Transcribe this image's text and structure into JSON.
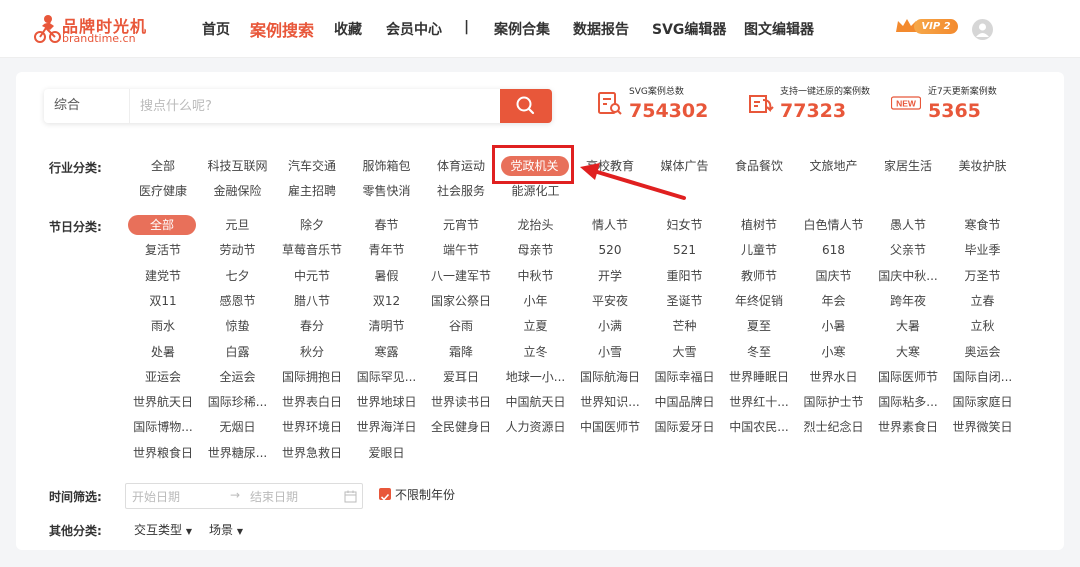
{
  "brand": {
    "name_cn": "品牌时光机",
    "name_en": "brandtime.cn"
  },
  "nav": [
    "首页",
    "案例搜索",
    "收藏",
    "会员中心",
    "|",
    "案例合集",
    "数据报告",
    "SVG编辑器",
    "图文编辑器"
  ],
  "nav_active": "案例搜索",
  "vip_label": "VIP 2",
  "search": {
    "type": "综合",
    "placeholder": "搜点什么呢?"
  },
  "stats": [
    {
      "label": "SVG案例总数",
      "value": "754302",
      "icon": "document-search-icon"
    },
    {
      "label": "支持一键还原的案例数",
      "value": "77323",
      "icon": "restore-icon"
    },
    {
      "label": "近7天更新案例数",
      "value": "5365",
      "icon": "new-badge-icon",
      "badge": "NEW"
    }
  ],
  "industry": {
    "label": "行业分类:",
    "row1": [
      "全部",
      "科技互联网",
      "汽车交通",
      "服饰箱包",
      "体育运动",
      "党政机关",
      "高校教育",
      "媒体广告",
      "食品餐饮",
      "文旅地产",
      "家居生活",
      "美妆护肤"
    ],
    "row2": [
      "医疗健康",
      "金融保险",
      "雇主招聘",
      "零售快消",
      "社会服务",
      "能源化工"
    ],
    "selected": "党政机关"
  },
  "festival": {
    "label": "节日分类:",
    "selected": "全部",
    "rows": [
      [
        "全部",
        "元旦",
        "除夕",
        "春节",
        "元宵节",
        "龙抬头",
        "情人节",
        "妇女节",
        "植树节",
        "白色情人节",
        "愚人节",
        "寒食节"
      ],
      [
        "复活节",
        "劳动节",
        "草莓音乐节",
        "青年节",
        "端午节",
        "母亲节",
        "520",
        "521",
        "儿童节",
        "618",
        "父亲节",
        "毕业季"
      ],
      [
        "建党节",
        "七夕",
        "中元节",
        "暑假",
        "八一建军节",
        "中秋节",
        "开学",
        "重阳节",
        "教师节",
        "国庆节",
        "国庆中秋...",
        "万圣节"
      ],
      [
        "双11",
        "感恩节",
        "腊八节",
        "双12",
        "国家公祭日",
        "小年",
        "平安夜",
        "圣诞节",
        "年终促销",
        "年会",
        "跨年夜",
        "立春"
      ],
      [
        "雨水",
        "惊蛰",
        "春分",
        "清明节",
        "谷雨",
        "立夏",
        "小满",
        "芒种",
        "夏至",
        "小暑",
        "大暑",
        "立秋"
      ],
      [
        "处暑",
        "白露",
        "秋分",
        "寒露",
        "霜降",
        "立冬",
        "小雪",
        "大雪",
        "冬至",
        "小寒",
        "大寒",
        "奥运会"
      ],
      [
        "亚运会",
        "全运会",
        "国际拥抱日",
        "国际罕见...",
        "爱耳日",
        "地球一小...",
        "国际航海日",
        "国际幸福日",
        "世界睡眠日",
        "世界水日",
        "国际医师节",
        "国际自闭..."
      ],
      [
        "世界航天日",
        "国际珍稀...",
        "世界表白日",
        "世界地球日",
        "世界读书日",
        "中国航天日",
        "世界知识...",
        "中国品牌日",
        "世界红十...",
        "国际护士节",
        "国际粘多...",
        "国际家庭日"
      ],
      [
        "国际博物...",
        "无烟日",
        "世界环境日",
        "世界海洋日",
        "全民健身日",
        "人力资源日",
        "中国医师节",
        "国际爱牙日",
        "中国农民...",
        "烈士纪念日",
        "世界素食日",
        "世界微笑日"
      ],
      [
        "世界粮食日",
        "世界糖尿...",
        "世界急救日",
        "爱眼日"
      ]
    ]
  },
  "time_filter": {
    "label": "时间筛选:",
    "start_placeholder": "开始日期",
    "arrow": "→",
    "end_placeholder": "结束日期",
    "unlimited_label": "不限制年份",
    "unlimited_checked": true
  },
  "other": {
    "label": "其他分类:",
    "dropdowns": [
      "交互类型",
      "场景"
    ]
  },
  "colors": {
    "accent": "#e8573a",
    "highlight_box": "#e02020"
  }
}
